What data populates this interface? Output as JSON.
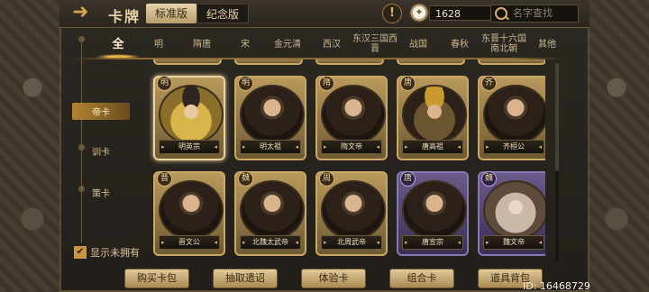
{
  "header": {
    "back_icon": "back-arrow-icon",
    "title": "卡牌",
    "version_tabs": [
      {
        "label": "标准版",
        "active": true
      },
      {
        "label": "纪念版",
        "active": false
      }
    ],
    "currency_amount": "1628",
    "search_placeholder": "名字查找"
  },
  "tabs": [
    {
      "label": "全",
      "active": true
    },
    {
      "label": "明"
    },
    {
      "label": "隋唐"
    },
    {
      "label": "宋"
    },
    {
      "label": "金元清"
    },
    {
      "label": "西汉"
    },
    {
      "label": "东汉三国西晋"
    },
    {
      "label": "战国"
    },
    {
      "label": "春秋"
    },
    {
      "label": "东晋十六国南北朝"
    },
    {
      "label": "其他"
    }
  ],
  "rail": {
    "items": [
      {
        "label": "帝卡",
        "active": true
      },
      {
        "label": "训卡"
      },
      {
        "label": "策卡"
      }
    ]
  },
  "cards": [
    {
      "name": "明英宗",
      "badge": "明",
      "rarity": "gold",
      "style": "bright",
      "selected": true
    },
    {
      "name": "明太祖",
      "badge": "明",
      "rarity": "gold",
      "style": "dark"
    },
    {
      "name": "隋文帝",
      "badge": "隋",
      "rarity": "gold",
      "style": "dark"
    },
    {
      "name": "唐高祖",
      "badge": "唐",
      "rarity": "gold",
      "style": "hat-gold"
    },
    {
      "name": "齐桓公",
      "badge": "齐",
      "rarity": "gold",
      "style": "dark"
    },
    {
      "name": "晋文公",
      "badge": "晋",
      "rarity": "gold",
      "style": "dark"
    },
    {
      "name": "北魏太武帝",
      "badge": "魏",
      "rarity": "gold",
      "style": "dark"
    },
    {
      "name": "北周武帝",
      "badge": "周",
      "rarity": "gold",
      "style": "dark"
    },
    {
      "name": "唐宣宗",
      "badge": "唐",
      "rarity": "purple",
      "style": "dark"
    },
    {
      "name": "魏文帝",
      "badge": "魏",
      "rarity": "purple",
      "style": "pale"
    }
  ],
  "show_unowned": {
    "label": "显示未拥有",
    "checked": true
  },
  "bottom_buttons": [
    "购买卡包",
    "抽取遗诏",
    "体验卡",
    "组合卡",
    "道具背包"
  ],
  "user_id": "ID: 16468729"
}
